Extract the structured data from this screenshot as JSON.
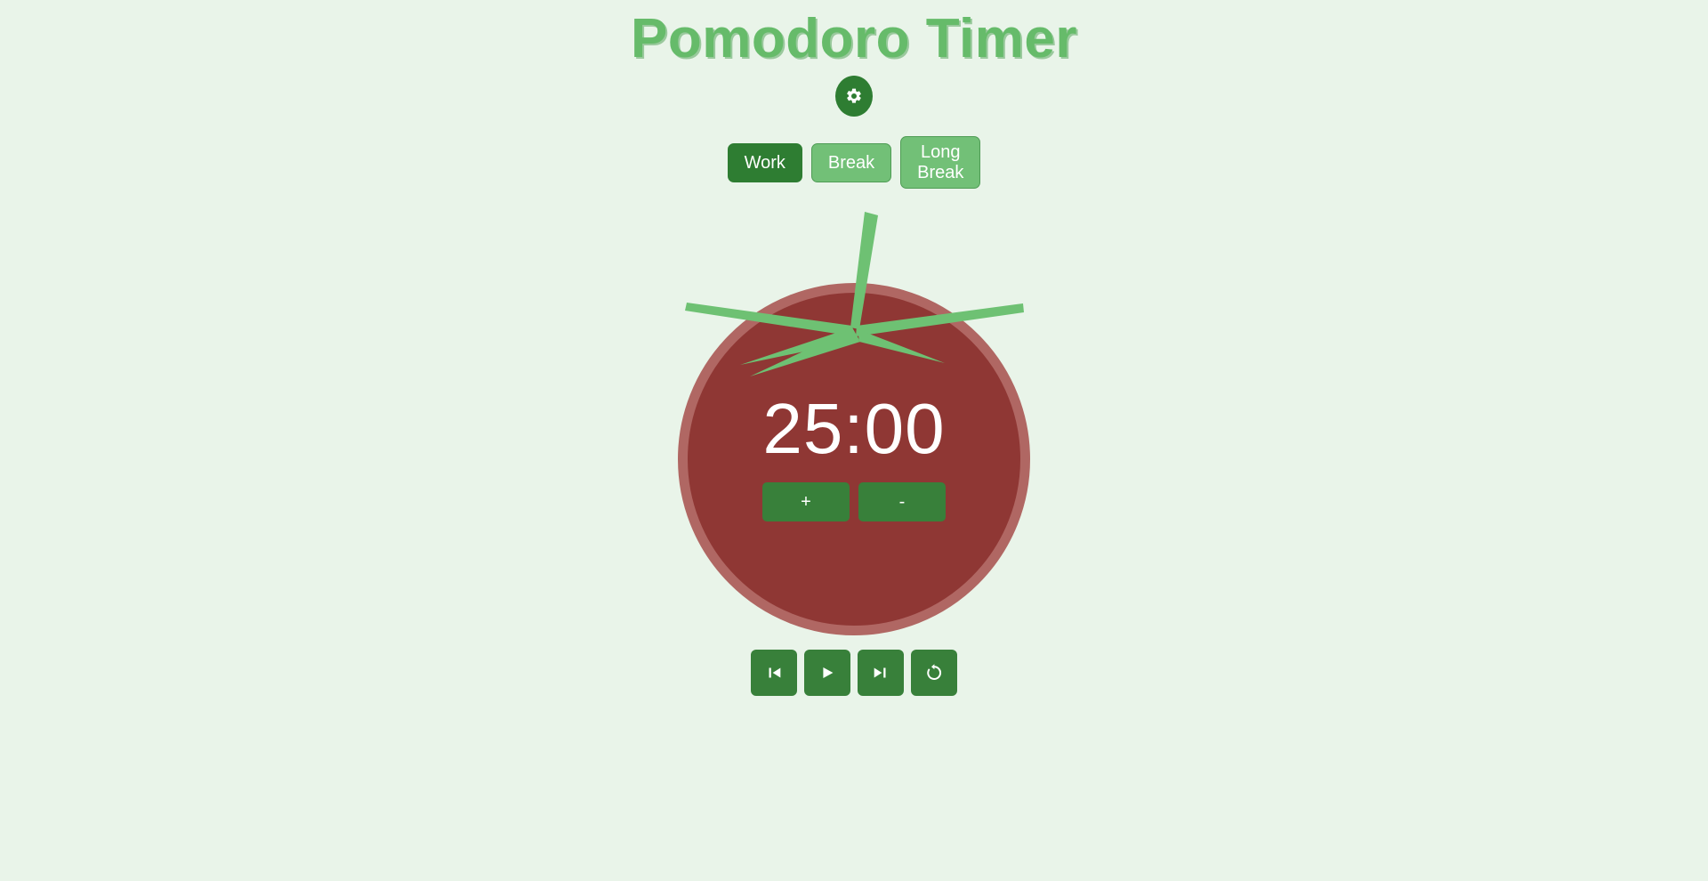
{
  "app": {
    "title": "Pomodoro Timer",
    "background_color": "#e9f4e9",
    "title_color": "#66bb6a"
  },
  "settings": {
    "icon": "gear-icon",
    "aria_label": "Settings",
    "background_color": "#2e7d32"
  },
  "modes": {
    "active_mode": "Work",
    "items": [
      {
        "label": "Work",
        "active": true,
        "background_color": "#2e7d32"
      },
      {
        "label": "Break",
        "active": false,
        "background_color": "#72c077"
      },
      {
        "label": "Long\nBreak",
        "active": false,
        "background_color": "#72c077"
      }
    ]
  },
  "timer": {
    "display": "25:00",
    "minutes": 25,
    "seconds": 0,
    "text_color": "#ffffff",
    "tomato_body_color": "#8f3734",
    "tomato_ring_color": "#b06763",
    "leaf_color": "#6ec173"
  },
  "adjusters": [
    {
      "label": "+",
      "name": "increase-time-button"
    },
    {
      "label": "-",
      "name": "decrease-time-button"
    }
  ],
  "controls": [
    {
      "icon": "skip-previous-icon",
      "aria_label": "Previous"
    },
    {
      "icon": "play-icon",
      "aria_label": "Start"
    },
    {
      "icon": "skip-next-icon",
      "aria_label": "Next"
    },
    {
      "icon": "reset-icon",
      "aria_label": "Reset"
    }
  ]
}
